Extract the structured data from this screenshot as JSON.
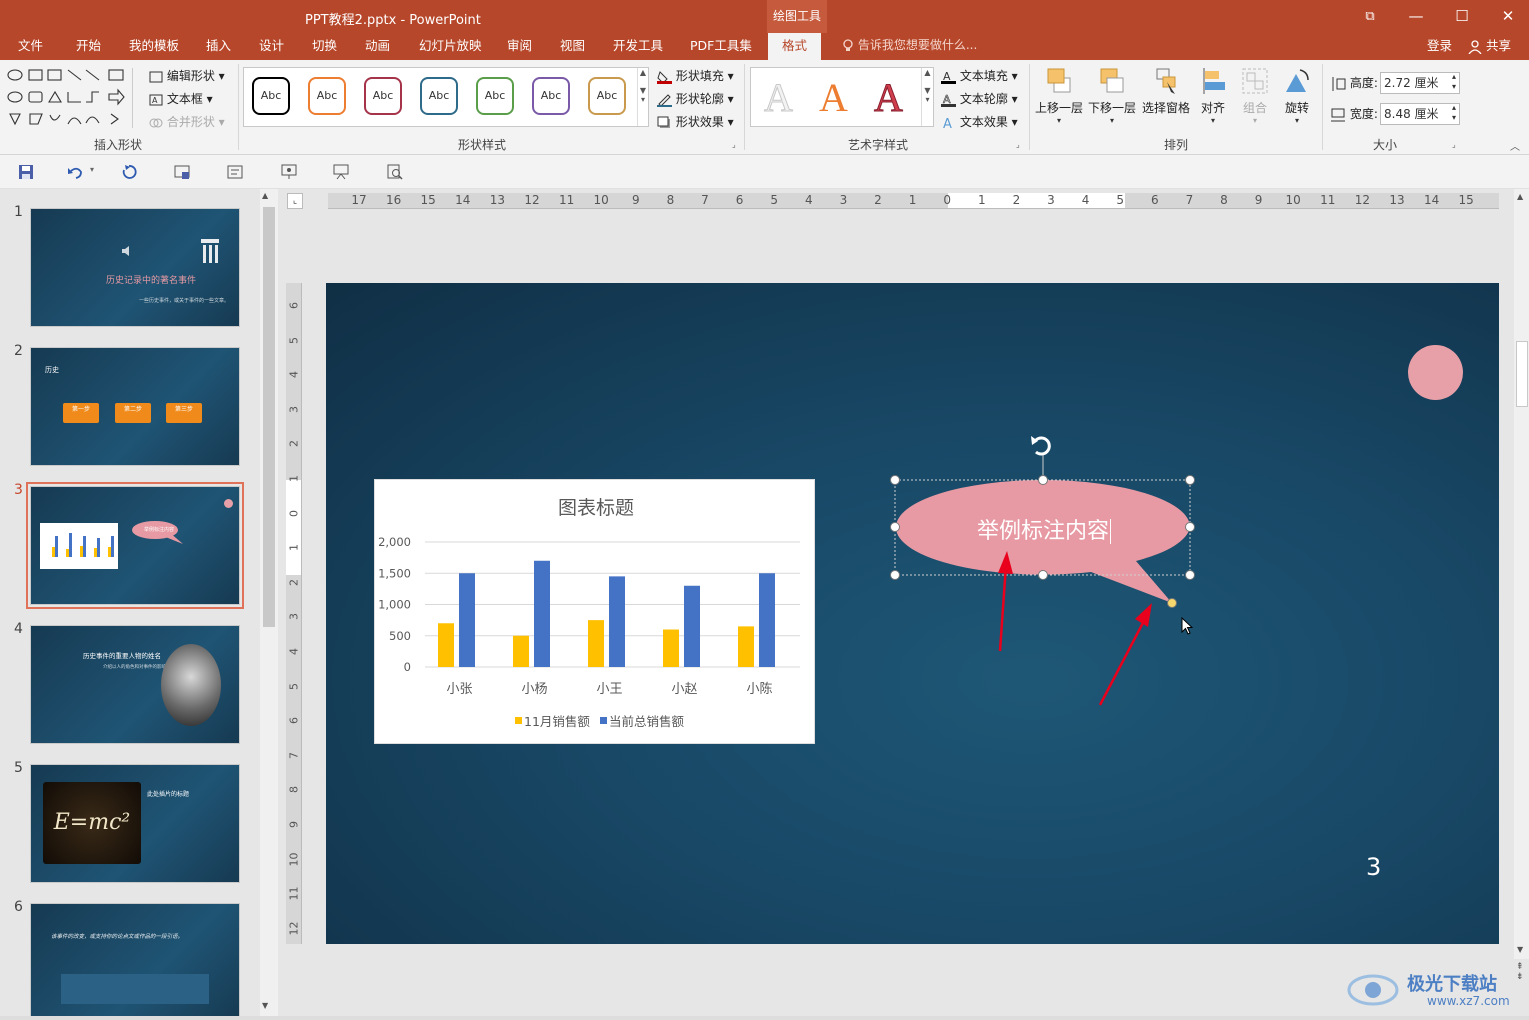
{
  "window": {
    "title": "PPT教程2.pptx - PowerPoint",
    "context_group": "绘图工具",
    "controls": {
      "restore": "⧉",
      "minimize": "—",
      "maximize": "☐",
      "close": "✕"
    }
  },
  "tabs": [
    "文件",
    "开始",
    "我的模板",
    "插入",
    "设计",
    "切换",
    "动画",
    "幻灯片放映",
    "审阅",
    "视图",
    "开发工具",
    "PDF工具集",
    "格式"
  ],
  "active_tab": "格式",
  "tell_me": "告诉我您想要做什么...",
  "login": "登录",
  "share": "共享",
  "ribbon": {
    "insert_shapes": {
      "label": "插入形状",
      "edit_shape": "编辑形状",
      "textbox": "文本框",
      "merge_shapes": "合并形状"
    },
    "shape_styles": {
      "label": "形状样式",
      "sample": "Abc",
      "fill": "形状填充",
      "outline": "形状轮廓",
      "effects": "形状效果",
      "style_colors": [
        "#000000",
        "#ed7d31",
        "#a5344a",
        "#2e6b8a",
        "#5a9e4a",
        "#7a5aa8",
        "#c99a4e"
      ]
    },
    "wordart": {
      "label": "艺术字样式",
      "glyph": "A",
      "text_fill": "文本填充",
      "text_outline": "文本轮廓",
      "text_effects": "文本效果"
    },
    "arrange": {
      "label": "排列",
      "bring_forward": "上移一层",
      "send_backward": "下移一层",
      "selection_pane": "选择窗格",
      "align": "对齐",
      "group": "组合",
      "rotate": "旋转"
    },
    "size": {
      "label": "大小",
      "height_label": "高度:",
      "height_value": "2.72 厘米",
      "width_label": "宽度:",
      "width_value": "8.48 厘米"
    }
  },
  "thumbnails": [
    {
      "num": "1",
      "title": "历史记录中的著名事件",
      "subtitle": "一些历史事件，或关于事件的一些文章。"
    },
    {
      "num": "2",
      "title": "历史",
      "steps": [
        "第一步",
        "第二步",
        "第三步"
      ]
    },
    {
      "num": "3",
      "callout": "举例标注内容"
    },
    {
      "num": "4",
      "title": "历史事件的重要人物的姓名",
      "subtitle": "介绍以人的角色和对事件的影响。"
    },
    {
      "num": "5",
      "title": "此处插片的标题",
      "formula": "E=mc²"
    },
    {
      "num": "6",
      "quote": "该事件的改变，或支持你的论点文或作品的一段引语。"
    }
  ],
  "ruler": {
    "h_ticks": [
      "17",
      "16",
      "15",
      "14",
      "13",
      "12",
      "11",
      "10",
      "9",
      "8",
      "7",
      "6",
      "5",
      "4",
      "3",
      "2",
      "1",
      "0",
      "1",
      "2",
      "3",
      "4",
      "5",
      "6",
      "7",
      "8",
      "9",
      "10",
      "11",
      "12",
      "13",
      "14",
      "15"
    ],
    "v_ticks": [
      "6",
      "5",
      "4",
      "3",
      "2",
      "1",
      "0",
      "1",
      "2",
      "3",
      "4",
      "5",
      "6",
      "7",
      "8",
      "9",
      "10",
      "11",
      "12"
    ]
  },
  "slide": {
    "callout_text": "举例标注内容",
    "page_number": "3",
    "circle_color": "#e8a0a8",
    "callout_color": "#e79aa3"
  },
  "chart_data": {
    "type": "bar",
    "title": "图表标题",
    "categories": [
      "小张",
      "小杨",
      "小王",
      "小赵",
      "小陈"
    ],
    "series": [
      {
        "name": "11月销售额",
        "color": "#ffc000",
        "values": [
          700,
          500,
          750,
          600,
          650
        ]
      },
      {
        "name": "当前总销售额",
        "color": "#4472c4",
        "values": [
          1500,
          1700,
          1450,
          1300,
          1500
        ]
      }
    ],
    "ylim": [
      0,
      2000
    ],
    "yticks": [
      "2,000",
      "1,500",
      "1,000",
      "500",
      "0"
    ],
    "ytick_values": [
      2000,
      1500,
      1000,
      500,
      0
    ],
    "legend": "bottom",
    "grid": true
  },
  "watermark": {
    "text": "极光下载站",
    "url": "www.xz7.com"
  }
}
